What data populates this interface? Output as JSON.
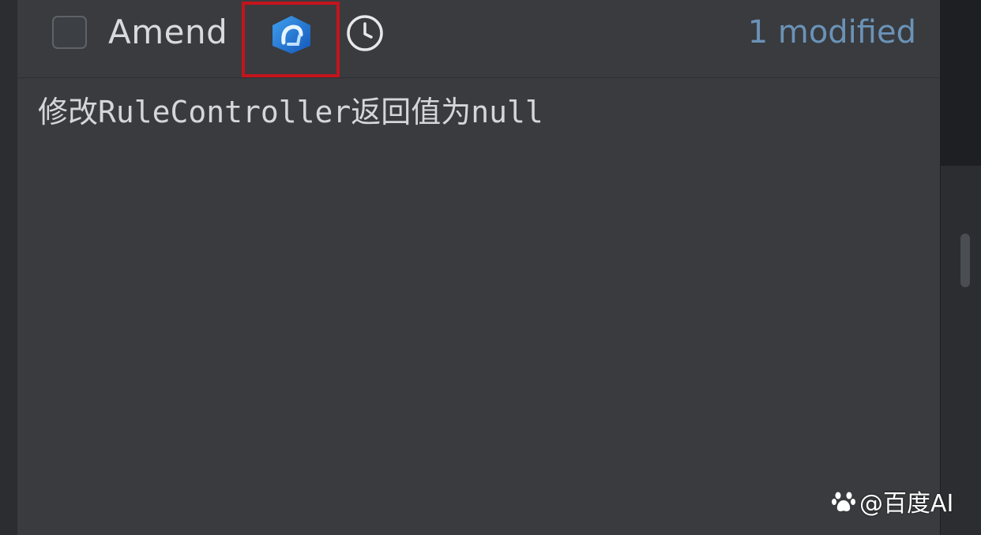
{
  "toolbar": {
    "amend_label": "Amend",
    "amend_checked": false,
    "ai_icon": "ai-assistant-icon",
    "history_icon": "clock-icon",
    "modified_count": "1 modified"
  },
  "commit": {
    "message": "修改RuleController返回值为null"
  },
  "watermark": {
    "text": "@百度AI",
    "logo": "baidu-paw-logo"
  },
  "colors": {
    "panel_bg": "#393b3f",
    "highlight_border": "#c3141d",
    "modified_text": "#6b93b8",
    "ai_icon_blue": "#1f7ad6"
  }
}
